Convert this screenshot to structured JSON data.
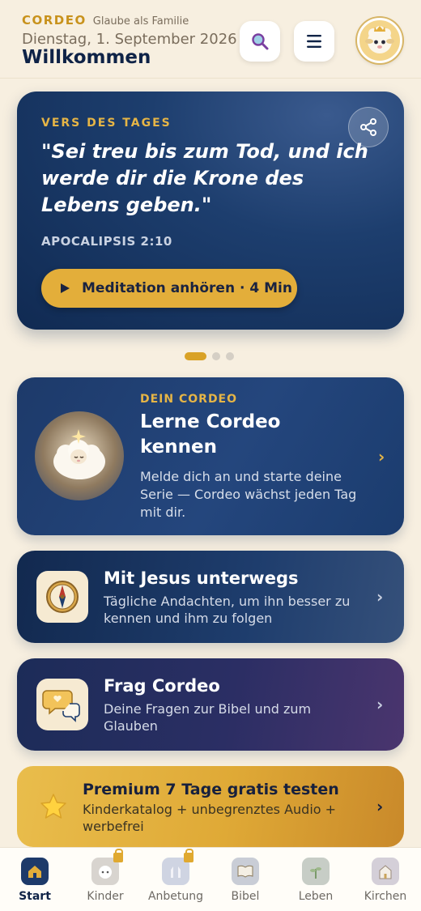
{
  "header": {
    "brand": "CORDEO",
    "tagline": "Glaube als Familie",
    "date": "Dienstag, 1. September 2026",
    "welcome": "Willkommen"
  },
  "verse": {
    "label": "VERS DES TAGES",
    "text": "\"Sei treu bis zum Tod, und ich werde dir die Krone des Lebens geben.\"",
    "reference": "APOCALIPSIS 2:10",
    "play_label": "Meditation anhören · 4 Min"
  },
  "carousel": {
    "pages": 3,
    "active": 1
  },
  "cordeo_card": {
    "kicker": "DEIN CORDEO",
    "title": "Lerne Cordeo kennen",
    "description": "Melde dich an und starte deine Serie — Cordeo wächst jeden Tag mit dir."
  },
  "features": [
    {
      "title": "Mit Jesus unterwegs",
      "description": "Tägliche Andachten, um ihn besser zu kennen und ihm zu folgen",
      "icon": "compass-icon"
    },
    {
      "title": "Frag Cordeo",
      "description": "Deine Fragen zur Bibel und zum Glauben",
      "icon": "chat-bubbles-icon"
    }
  ],
  "premium": {
    "title": "Premium 7 Tage gratis testen",
    "description": "Kinderkatalog + unbegrenztes Audio + werbefrei"
  },
  "tabs": [
    {
      "label": "Start",
      "active": true,
      "locked": false
    },
    {
      "label": "Kinder",
      "active": false,
      "locked": true
    },
    {
      "label": "Anbetung",
      "active": false,
      "locked": true
    },
    {
      "label": "Bibel",
      "active": false,
      "locked": false
    },
    {
      "label": "Leben",
      "active": false,
      "locked": false
    },
    {
      "label": "Kirchen",
      "active": false,
      "locked": false
    }
  ],
  "colors": {
    "background": "#f7efe0",
    "accent_gold": "#e3ae3a",
    "navy": "#0f2347"
  }
}
